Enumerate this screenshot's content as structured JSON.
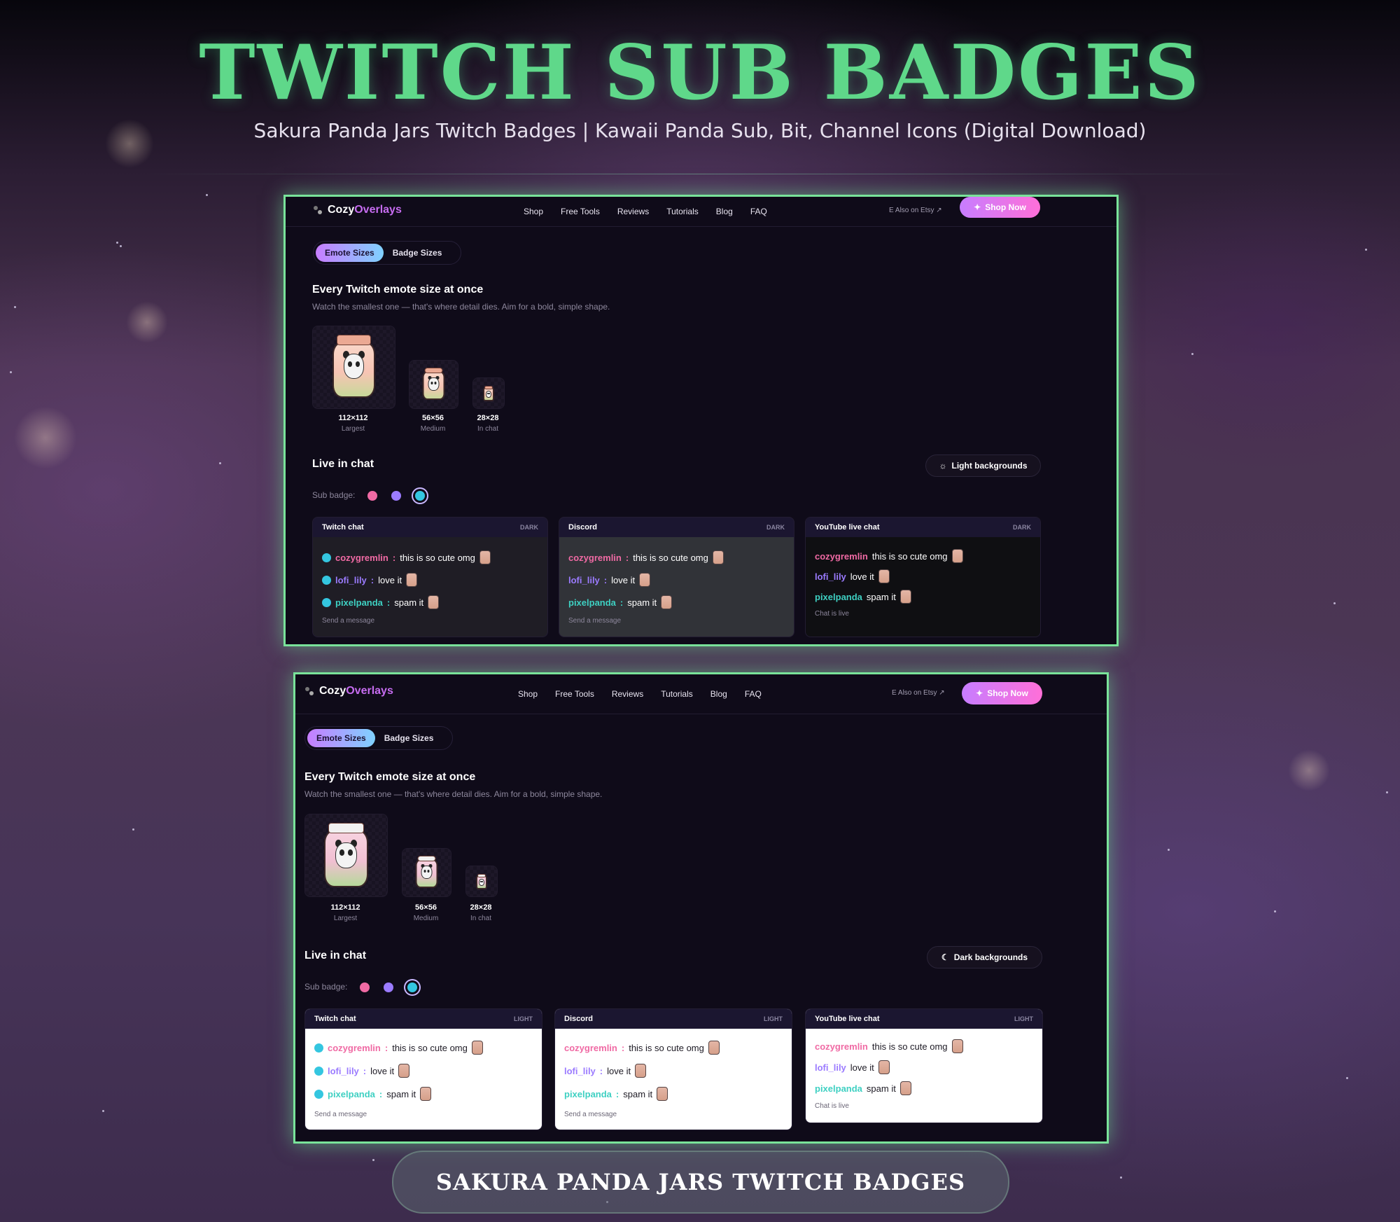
{
  "hero": {
    "title": "TWITCH SUB BADGES",
    "subtitle": "Sakura Panda Jars Twitch Badges | Kawaii Panda Sub, Bit, Channel Icons (Digital Download)"
  },
  "site": {
    "logo_a": "Cozy",
    "logo_b": "Overlays",
    "nav": [
      "Shop",
      "Free Tools",
      "Reviews",
      "Tutorials",
      "Blog",
      "FAQ"
    ],
    "etsy_link": "Also on Etsy ↗",
    "shop_now": "Shop Now",
    "tabs": [
      "Emote Sizes",
      "Badge Sizes"
    ],
    "heading": "Every Twitch emote size at once",
    "description": "Watch the smallest one — that's where detail dies. Aim for a bold, simple shape.",
    "sizes": [
      {
        "label": "112×112",
        "sub": "Largest"
      },
      {
        "label": "56×56",
        "sub": "Medium"
      },
      {
        "label": "28×28",
        "sub": "In chat"
      }
    ],
    "live_heading": "Live in chat",
    "sub_badge_label": "Sub badge:",
    "badge_colors": [
      "#f06aa4",
      "#9b7bff",
      "#34c6e0"
    ],
    "messages": [
      {
        "user": "cozygremlin",
        "text": "this is so cute omg"
      },
      {
        "user": "lofi_lily",
        "text": "love it"
      },
      {
        "user": "pixelpanda",
        "text": "spam it"
      }
    ],
    "panel_names": [
      "Twitch chat",
      "Discord",
      "YouTube live chat"
    ],
    "send_message": "Send a message",
    "chat_live": "Chat is live"
  },
  "screens": [
    {
      "theme_button": "Light backgrounds",
      "mode": "DARK"
    },
    {
      "theme_button": "Dark backgrounds",
      "mode": "LIGHT"
    }
  ],
  "cta": "SAKURA PANDA JARS TWITCH BADGES"
}
